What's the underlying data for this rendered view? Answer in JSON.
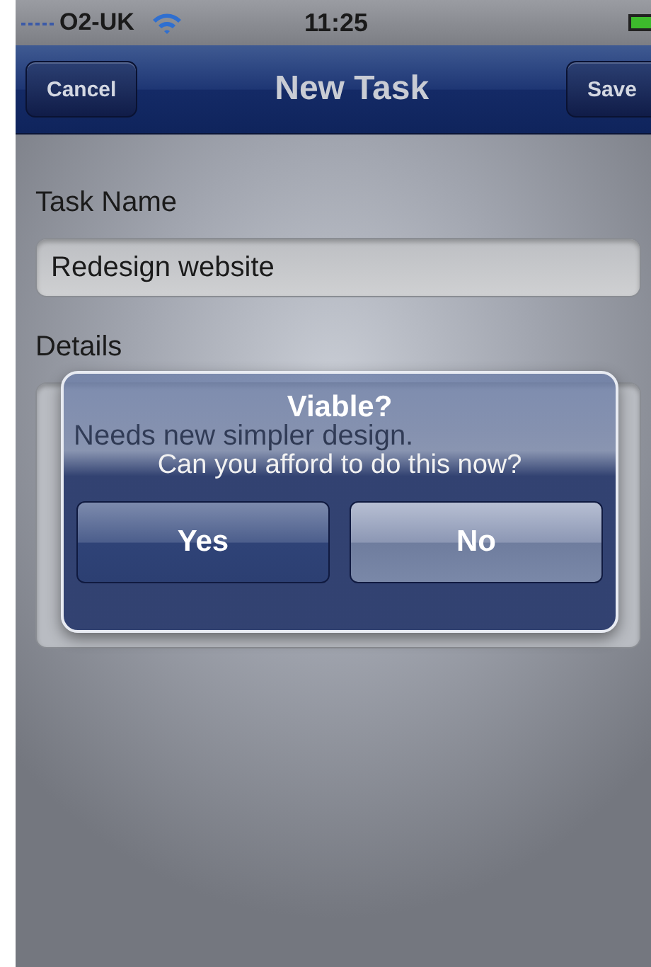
{
  "status_bar": {
    "carrier": "O2-UK",
    "time": "11:25"
  },
  "nav_bar": {
    "title": "New Task",
    "left_button": "Cancel",
    "right_button": "Save"
  },
  "form": {
    "fields": [
      {
        "label": "Task Name",
        "value": "Redesign website",
        "kind": "line"
      },
      {
        "label": "Details",
        "value": "Needs new simpler design.",
        "kind": "area"
      }
    ]
  },
  "alert": {
    "title": "Viable?",
    "message": "Can you afford to do this now?",
    "buttons": [
      {
        "label": "Yes",
        "kind": "plain"
      },
      {
        "label": "No",
        "kind": "default"
      }
    ]
  }
}
